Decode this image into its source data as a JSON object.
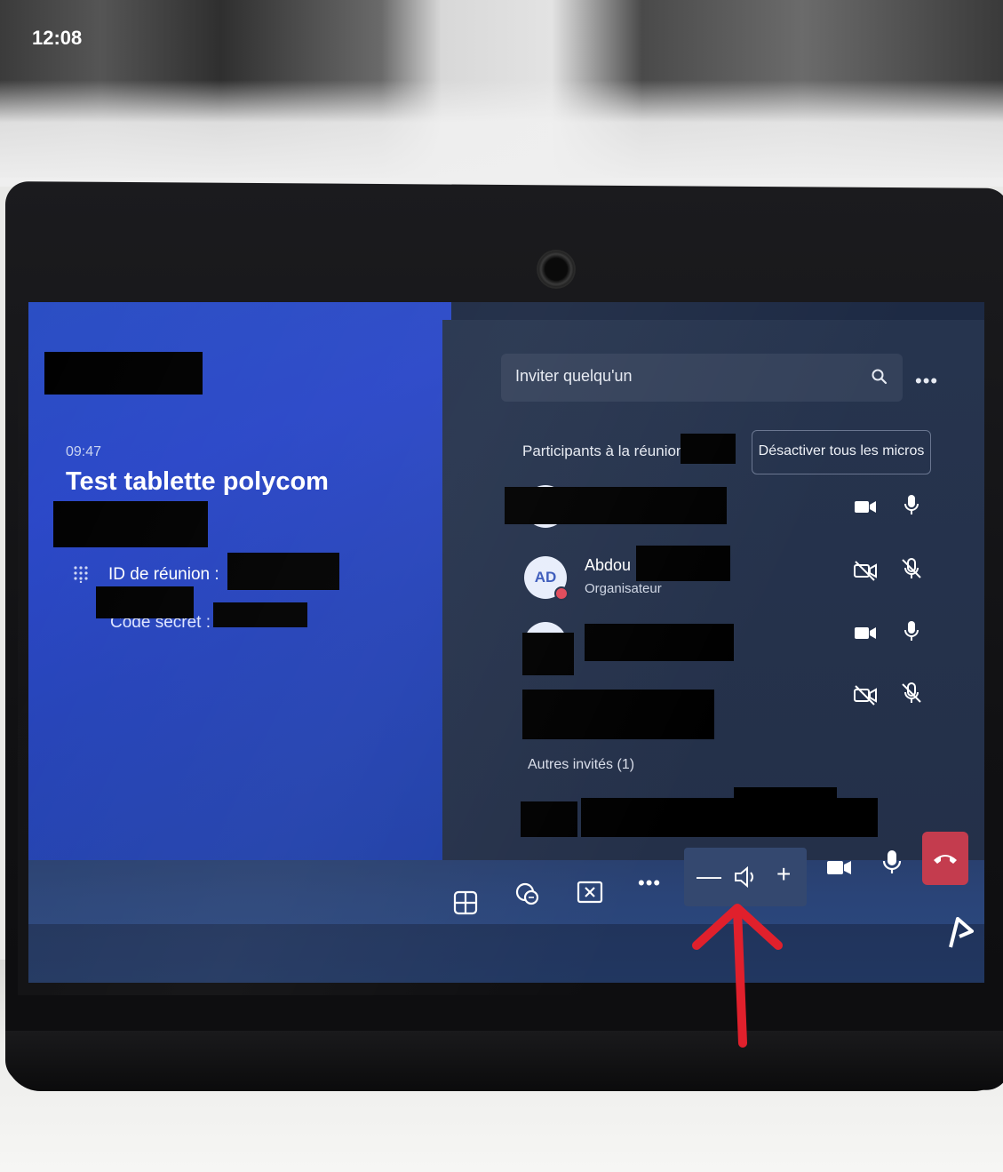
{
  "screen": {
    "clock": "12:08",
    "meeting": {
      "start_time": "09:47",
      "title": "Test tablette polycom",
      "meeting_id_label": "ID de réunion :",
      "secret_code_label": "Code secret :"
    }
  },
  "roster": {
    "invite_placeholder": "Inviter quelqu'un",
    "more_label": "•••",
    "participants_label": "Participants à la réunion",
    "mute_all_label": "Désactiver tous les micros",
    "participants": [
      {
        "avatar_initials": "",
        "name": "",
        "role": "",
        "video": "on",
        "mic": "on"
      },
      {
        "avatar_initials": "AD",
        "name": "Abdou",
        "role": "Organisateur",
        "video": "off",
        "mic": "off"
      },
      {
        "avatar_initials": "",
        "name": "",
        "role": "",
        "video": "on",
        "mic": "on"
      },
      {
        "avatar_initials": "",
        "name": "",
        "role": "",
        "video": "off",
        "mic": "off"
      }
    ],
    "others_label": "Autres invités (1)"
  },
  "toolbar": {
    "more_label": "•••",
    "volume_minus": "—",
    "volume_plus": "+",
    "icons": [
      "layout-icon",
      "share-content-icon",
      "close-panel-icon",
      "more-icon",
      "volume-icon",
      "camera-icon",
      "microphone-icon",
      "hang-up-icon"
    ]
  },
  "colors": {
    "left_panel": "#2a47c8",
    "right_panel": "#26344e",
    "hangup": "#c43c4e",
    "annotation_arrow": "#e0202c"
  }
}
